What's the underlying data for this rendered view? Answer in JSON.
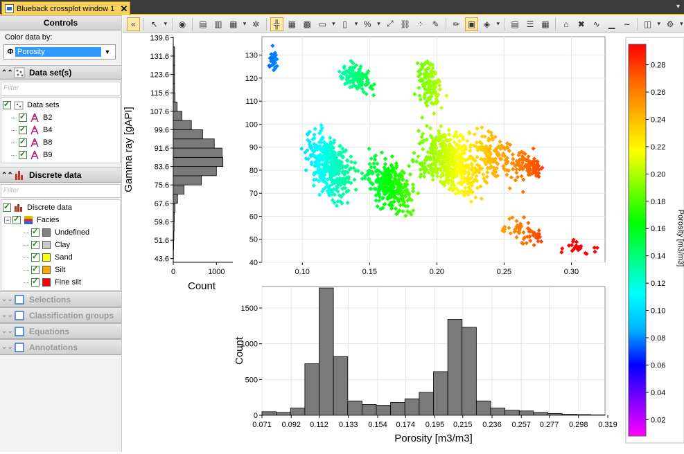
{
  "tab": {
    "title": "Blueback crossplot window 1",
    "close": "✕"
  },
  "controls": {
    "title": "Controls",
    "color_by_label": "Color data by:",
    "color_by_value": "Porosity",
    "filter_placeholder": "Filter"
  },
  "datasets": {
    "title": "Data set(s)",
    "root": "Data sets",
    "items": [
      "B2",
      "B4",
      "B8",
      "B9"
    ]
  },
  "discrete": {
    "title": "Discrete data",
    "root": "Discrete data",
    "facies": "Facies",
    "items": [
      {
        "label": "Undefined",
        "color": "#808080"
      },
      {
        "label": "Clay",
        "color": "#c8c8c8"
      },
      {
        "label": "Sand",
        "color": "#ffff00"
      },
      {
        "label": "Silt",
        "color": "#ffa500"
      },
      {
        "label": "Fine silt",
        "color": "#ff0000"
      }
    ]
  },
  "collapsed_sections": [
    "Selections",
    "Classification groups",
    "Equations",
    "Annotations"
  ],
  "chart_data": [
    {
      "type": "scatter",
      "name": "crossplot",
      "xlabel": "",
      "ylabel": "Gamma ray [gAPI]",
      "xlim": [
        0.07,
        0.325
      ],
      "ylim": [
        40,
        138
      ],
      "x_ticks": [
        "0.10",
        "0.15",
        "0.20",
        "0.25",
        "0.30"
      ],
      "y_ticks": [
        "40",
        "50",
        "60",
        "70",
        "80",
        "90",
        "100",
        "110",
        "120",
        "130"
      ],
      "color_by": "Porosity",
      "clusters": [
        {
          "x": [
            0.072,
            0.085
          ],
          "y": [
            118,
            137
          ],
          "n": 35
        },
        {
          "x": [
            0.095,
            0.145
          ],
          "y": [
            62,
            102
          ],
          "n": 400
        },
        {
          "x": [
            0.12,
            0.16
          ],
          "y": [
            110,
            130
          ],
          "n": 110
        },
        {
          "x": [
            0.14,
            0.19
          ],
          "y": [
            55,
            92
          ],
          "n": 300
        },
        {
          "x": [
            0.175,
            0.245
          ],
          "y": [
            62,
            105
          ],
          "n": 500
        },
        {
          "x": [
            0.18,
            0.21
          ],
          "y": [
            100,
            133
          ],
          "n": 120
        },
        {
          "x": [
            0.21,
            0.28
          ],
          "y": [
            68,
            103
          ],
          "n": 150
        },
        {
          "x": [
            0.255,
            0.285
          ],
          "y": [
            74,
            90
          ],
          "n": 70
        },
        {
          "x": [
            0.24,
            0.29
          ],
          "y": [
            44,
            62
          ],
          "n": 60
        },
        {
          "x": [
            0.285,
            0.325
          ],
          "y": [
            40,
            52
          ],
          "n": 25
        }
      ]
    },
    {
      "type": "bar",
      "name": "gamma-ray-histogram",
      "orientation": "horizontal",
      "xlabel": "Count",
      "ylabel": "Gamma ray [gAPI]",
      "x_ticks": [
        "0",
        "1000"
      ],
      "y_ticks": [
        "43.6",
        "51.6",
        "59.6",
        "67.6",
        "75.6",
        "83.6",
        "91.6",
        "99.6",
        "107.6",
        "115.6",
        "123.6",
        "131.6",
        "139.6"
      ],
      "bins": [
        43.6,
        47.6,
        51.6,
        55.6,
        59.6,
        63.6,
        67.6,
        71.6,
        75.6,
        79.6,
        83.6,
        87.6,
        91.6,
        95.6,
        99.6,
        103.6,
        107.6,
        111.6,
        115.6,
        119.6,
        123.6,
        127.6,
        131.6,
        135.6
      ],
      "values": [
        5,
        10,
        15,
        20,
        25,
        40,
        100,
        250,
        650,
        1000,
        1150,
        1130,
        950,
        680,
        420,
        200,
        90,
        40,
        30,
        30,
        30,
        30,
        30
      ],
      "xlim": [
        0,
        1380
      ]
    },
    {
      "type": "bar",
      "name": "porosity-histogram",
      "xlabel": "Porosity [m3/m3]",
      "ylabel": "Count",
      "x_ticks": [
        "0.071",
        "0.092",
        "0.112",
        "0.133",
        "0.154",
        "0.174",
        "0.195",
        "0.215",
        "0.236",
        "0.257",
        "0.277",
        "0.298",
        "0.319"
      ],
      "y_ticks": [
        "0",
        "500",
        "1000",
        "1500"
      ],
      "bin_start": 0.071,
      "bin_width": 0.01025,
      "values": [
        50,
        40,
        100,
        720,
        1780,
        820,
        200,
        150,
        140,
        180,
        230,
        320,
        610,
        1340,
        1230,
        200,
        100,
        70,
        60,
        40,
        25,
        15,
        10,
        5
      ],
      "ylim": [
        0,
        1800
      ]
    },
    {
      "type": "heatmap",
      "name": "porosity-colorbar",
      "label": "Porosity [m3/m3]",
      "range": [
        0.008,
        0.295
      ],
      "ticks": [
        "0.02",
        "0.04",
        "0.06",
        "0.08",
        "0.10",
        "0.12",
        "0.14",
        "0.16",
        "0.18",
        "0.20",
        "0.22",
        "0.24",
        "0.26",
        "0.28"
      ],
      "colors": [
        "#ff00ff",
        "#7f00ff",
        "#0000ff",
        "#00b4ff",
        "#00ffff",
        "#00ff7f",
        "#00ff00",
        "#7fff00",
        "#ffff00",
        "#ffb400",
        "#ff6400",
        "#ff0000"
      ]
    }
  ]
}
